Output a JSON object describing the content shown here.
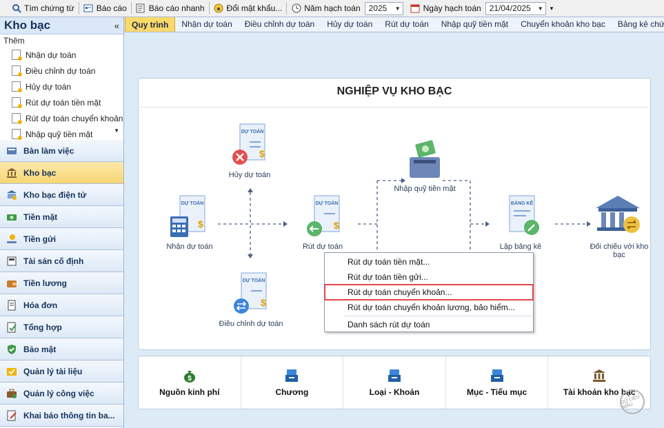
{
  "toolbar": {
    "search_label": "Tìm chứng từ",
    "report_label": "Báo cáo",
    "quick_report_label": "Báo cáo nhanh",
    "change_password_label": "Đổi mật khẩu...",
    "fiscal_year_label": "Năm hạch toán",
    "fiscal_year_value": "2025",
    "posting_date_label": "Ngày hạch toán",
    "posting_date_value": "21/04/2025"
  },
  "left_panel": {
    "title": "Kho bạc",
    "add_label": "Thêm",
    "quick_items": [
      "Nhận dự toán",
      "Điều chỉnh dự toán",
      "Hủy dự toán",
      "Rút dự toán tiền mặt",
      "Rút dự toán chuyển khoản",
      "Nhập quỹ tiền mặt"
    ],
    "nav": [
      "Bàn làm việc",
      "Kho bạc",
      "Kho bạc điện tử",
      "Tiền mặt",
      "Tiền gửi",
      "Tài sản cố định",
      "Tiền lương",
      "Hóa đơn",
      "Tổng hợp",
      "Bảo mật",
      "Quản lý tài liệu",
      "Quản lý công việc",
      "Khai báo thông tin ba..."
    ]
  },
  "tabs": [
    "Quy trình",
    "Nhận dự toán",
    "Điều chỉnh dự toán",
    "Hủy dự toán",
    "Rút dự toán",
    "Nhập quỹ tiền mặt",
    "Chuyển khoản kho bạc",
    "Bảng kê chứng từ thanh to"
  ],
  "workflow": {
    "title": "NGHIỆP VỤ KHO BẠC",
    "doc_tag": "DỰ TOÁN",
    "list_tag": "BẢNG KÊ",
    "cancel": "Hủy dự toán",
    "receive": "Nhận dự toán",
    "adjust": "Điều chỉnh dự toán",
    "withdraw": "Rút dự toán",
    "cash_deposit": "Nhập quỹ tiền mặt",
    "list": "Lập bảng kê",
    "reconcile": "Đối chiếu với kho bạc"
  },
  "context_menu": [
    "Rút dự toán tiền mặt...",
    "Rút dự toán tiền gửi...",
    "Rút dự toán chuyển khoản...",
    "Rút dự toán chuyển khoản lương, bảo hiểm...",
    "Danh sách rút dự toán"
  ],
  "categories": [
    "Nguồn kinh phí",
    "Chương",
    "Loại - Khoản",
    "Mục - Tiểu mục",
    "Tài khoản kho bạc"
  ],
  "watermark": "DỮ LIỆU MẪU"
}
